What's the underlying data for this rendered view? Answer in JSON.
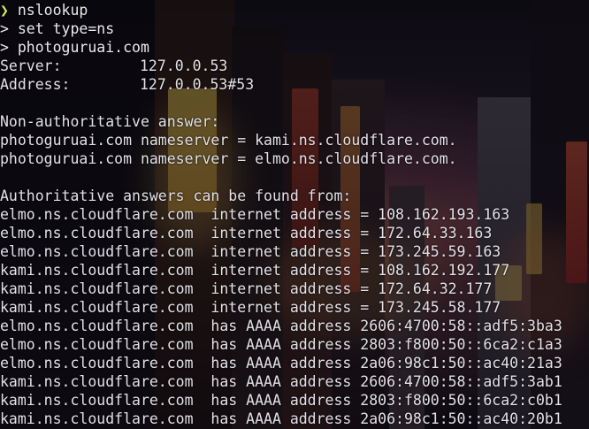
{
  "terminal": {
    "prompt_symbol": "❯",
    "command": "nslookup",
    "input_lines": [
      {
        "symbol": ">",
        "text": "set type=ns"
      },
      {
        "symbol": ">",
        "text": "photoguruai.com"
      }
    ],
    "server_label": "Server:",
    "server_value": "127.0.0.53",
    "address_label": "Address:",
    "address_value": "127.0.0.53#53",
    "non_auth_header": "Non-authoritative answer:",
    "nameserver_lines": [
      "photoguruai.com nameserver = kami.ns.cloudflare.com.",
      "photoguruai.com nameserver = elmo.ns.cloudflare.com."
    ],
    "auth_header": "Authoritative answers can be found from:",
    "address_lines": [
      "elmo.ns.cloudflare.com  internet address = 108.162.193.163",
      "elmo.ns.cloudflare.com  internet address = 172.64.33.163",
      "elmo.ns.cloudflare.com  internet address = 173.245.59.163",
      "kami.ns.cloudflare.com  internet address = 108.162.192.177",
      "kami.ns.cloudflare.com  internet address = 172.64.32.177",
      "kami.ns.cloudflare.com  internet address = 173.245.58.177",
      "elmo.ns.cloudflare.com  has AAAA address 2606:4700:58::adf5:3ba3",
      "elmo.ns.cloudflare.com  has AAAA address 2803:f800:50::6ca2:c1a3",
      "elmo.ns.cloudflare.com  has AAAA address 2a06:98c1:50::ac40:21a3",
      "kami.ns.cloudflare.com  has AAAA address 2606:4700:58::adf5:3ab1",
      "kami.ns.cloudflare.com  has AAAA address 2803:f800:50::6ca2:c0b1",
      "kami.ns.cloudflare.com  has AAAA address 2a06:98c1:50::ac40:20b1"
    ]
  },
  "colors": {
    "prompt": "#d9e84a",
    "text": "#e3e1e8"
  }
}
